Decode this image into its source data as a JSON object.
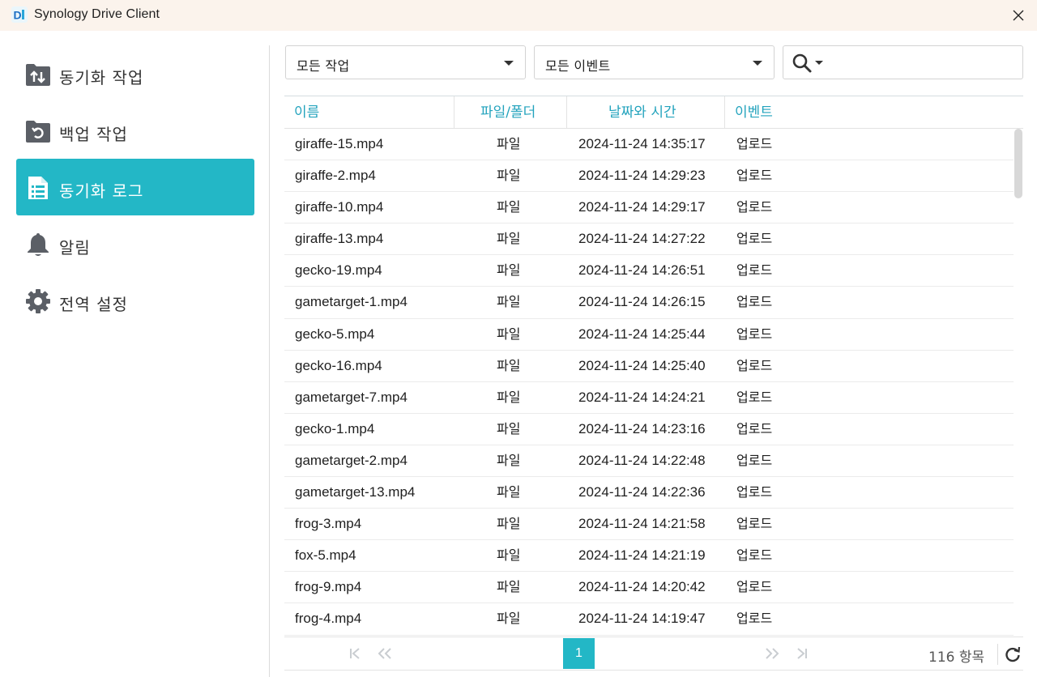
{
  "window": {
    "title": "Synology Drive Client"
  },
  "sidebar": {
    "items": [
      {
        "label": "동기화 작업",
        "icon": "sync-folder-icon"
      },
      {
        "label": "백업 작업",
        "icon": "backup-folder-icon"
      },
      {
        "label": "동기화 로그",
        "icon": "log-document-icon",
        "active": true
      },
      {
        "label": "알림",
        "icon": "bell-icon"
      },
      {
        "label": "전역 설정",
        "icon": "gear-icon"
      }
    ]
  },
  "filters": {
    "task": "모든 작업",
    "event": "모든 이벤트",
    "search_value": ""
  },
  "table": {
    "columns": [
      "이름",
      "파일/폴더",
      "날짜와 시간",
      "이벤트"
    ],
    "rows": [
      {
        "name": "giraffe-15.mp4",
        "type": "파일",
        "datetime": "2024-11-24 14:35:17",
        "event": "업로드"
      },
      {
        "name": "giraffe-2.mp4",
        "type": "파일",
        "datetime": "2024-11-24 14:29:23",
        "event": "업로드"
      },
      {
        "name": "giraffe-10.mp4",
        "type": "파일",
        "datetime": "2024-11-24 14:29:17",
        "event": "업로드"
      },
      {
        "name": "giraffe-13.mp4",
        "type": "파일",
        "datetime": "2024-11-24 14:27:22",
        "event": "업로드"
      },
      {
        "name": "gecko-19.mp4",
        "type": "파일",
        "datetime": "2024-11-24 14:26:51",
        "event": "업로드"
      },
      {
        "name": "gametarget-1.mp4",
        "type": "파일",
        "datetime": "2024-11-24 14:26:15",
        "event": "업로드"
      },
      {
        "name": "gecko-5.mp4",
        "type": "파일",
        "datetime": "2024-11-24 14:25:44",
        "event": "업로드"
      },
      {
        "name": "gecko-16.mp4",
        "type": "파일",
        "datetime": "2024-11-24 14:25:40",
        "event": "업로드"
      },
      {
        "name": "gametarget-7.mp4",
        "type": "파일",
        "datetime": "2024-11-24 14:24:21",
        "event": "업로드"
      },
      {
        "name": "gecko-1.mp4",
        "type": "파일",
        "datetime": "2024-11-24 14:23:16",
        "event": "업로드"
      },
      {
        "name": "gametarget-2.mp4",
        "type": "파일",
        "datetime": "2024-11-24 14:22:48",
        "event": "업로드"
      },
      {
        "name": "gametarget-13.mp4",
        "type": "파일",
        "datetime": "2024-11-24 14:22:36",
        "event": "업로드"
      },
      {
        "name": "frog-3.mp4",
        "type": "파일",
        "datetime": "2024-11-24 14:21:58",
        "event": "업로드"
      },
      {
        "name": "fox-5.mp4",
        "type": "파일",
        "datetime": "2024-11-24 14:21:19",
        "event": "업로드"
      },
      {
        "name": "frog-9.mp4",
        "type": "파일",
        "datetime": "2024-11-24 14:20:42",
        "event": "업로드"
      },
      {
        "name": "frog-4.mp4",
        "type": "파일",
        "datetime": "2024-11-24 14:19:47",
        "event": "업로드"
      }
    ]
  },
  "pagination": {
    "current_page": "1",
    "total_items": "116 항목"
  },
  "colors": {
    "accent": "#23b7c6",
    "header_text": "#23a3bd",
    "icon_gray": "#5b5f66",
    "titlebar_bg": "#fbf3ec"
  }
}
